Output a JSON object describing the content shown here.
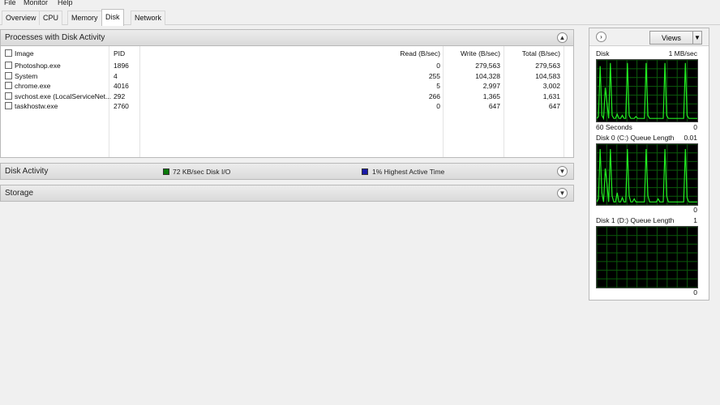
{
  "menu": [
    "File",
    "Monitor",
    "Help"
  ],
  "tabs": [
    "Overview",
    "CPU",
    "Memory",
    "Disk",
    "Network"
  ],
  "active_tab": "Disk",
  "processes": {
    "title": "Processes with Disk Activity",
    "columns": [
      "Image",
      "PID",
      "Read (B/sec)",
      "Write (B/sec)",
      "Total (B/sec)"
    ],
    "rows": [
      {
        "image": "Photoshop.exe",
        "pid": "1896",
        "read": "0",
        "write": "279,563",
        "total": "279,563"
      },
      {
        "image": "System",
        "pid": "4",
        "read": "255",
        "write": "104,328",
        "total": "104,583"
      },
      {
        "image": "chrome.exe",
        "pid": "4016",
        "read": "5",
        "write": "2,997",
        "total": "3,002"
      },
      {
        "image": "svchost.exe (LocalServiceNet...",
        "pid": "292",
        "read": "266",
        "write": "1,365",
        "total": "1,631"
      },
      {
        "image": "taskhostw.exe",
        "pid": "2760",
        "read": "0",
        "write": "647",
        "total": "647"
      }
    ]
  },
  "disk_activity": {
    "title": "Disk Activity",
    "io_text": "72 KB/sec Disk I/O",
    "io_color": "#0a7a0a",
    "active_text": "1% Highest Active Time",
    "active_color": "#1a1aa8"
  },
  "storage": {
    "title": "Storage"
  },
  "right_pane": {
    "views_label": "Views",
    "graphs": [
      {
        "title": "Disk",
        "max": "1 MB/sec",
        "time": "60 Seconds",
        "min": "0",
        "line_color": "#22ee22",
        "values": [
          0.05,
          0.08,
          0.9,
          0.1,
          0.05,
          0.55,
          0.3,
          0.05,
          0.95,
          0.1,
          0.05,
          0.05,
          0.12,
          0.05,
          0.05,
          0.1,
          0.05,
          0.05,
          0.95,
          0.1,
          0.05,
          0.05,
          0.05,
          0.08,
          0.05,
          0.05,
          0.05,
          0.05,
          0.05,
          0.95,
          0.1,
          0.05,
          0.05,
          0.05,
          0.05,
          0.05,
          0.05,
          0.05,
          0.05,
          0.05,
          0.95,
          0.1,
          0.05,
          0.05,
          0.05,
          0.05,
          0.05,
          0.05,
          0.05,
          0.05,
          0.05,
          0.05,
          0.95,
          0.1,
          0.05,
          0.05,
          0.05,
          0.05,
          0.05,
          0.05
        ]
      },
      {
        "title": "Disk 0 (C:) Queue Length",
        "max": "0.01",
        "min": "0",
        "line_color": "#22ee22",
        "values": [
          0.05,
          0.1,
          0.92,
          0.2,
          0.05,
          0.6,
          0.35,
          0.05,
          0.92,
          0.15,
          0.05,
          0.05,
          0.2,
          0.05,
          0.05,
          0.12,
          0.05,
          0.05,
          0.92,
          0.15,
          0.05,
          0.05,
          0.1,
          0.05,
          0.05,
          0.05,
          0.05,
          0.05,
          0.05,
          0.92,
          0.15,
          0.05,
          0.05,
          0.05,
          0.05,
          0.05,
          0.1,
          0.05,
          0.05,
          0.05,
          0.92,
          0.15,
          0.05,
          0.05,
          0.05,
          0.05,
          0.05,
          0.05,
          0.05,
          0.05,
          0.05,
          0.05,
          0.92,
          0.12,
          0.05,
          0.05,
          0.05,
          0.05,
          0.05,
          0.05
        ]
      },
      {
        "title": "Disk 1 (D:) Queue Length",
        "max": "1",
        "min": "0",
        "line_color": "#22ee22",
        "values": []
      }
    ]
  }
}
